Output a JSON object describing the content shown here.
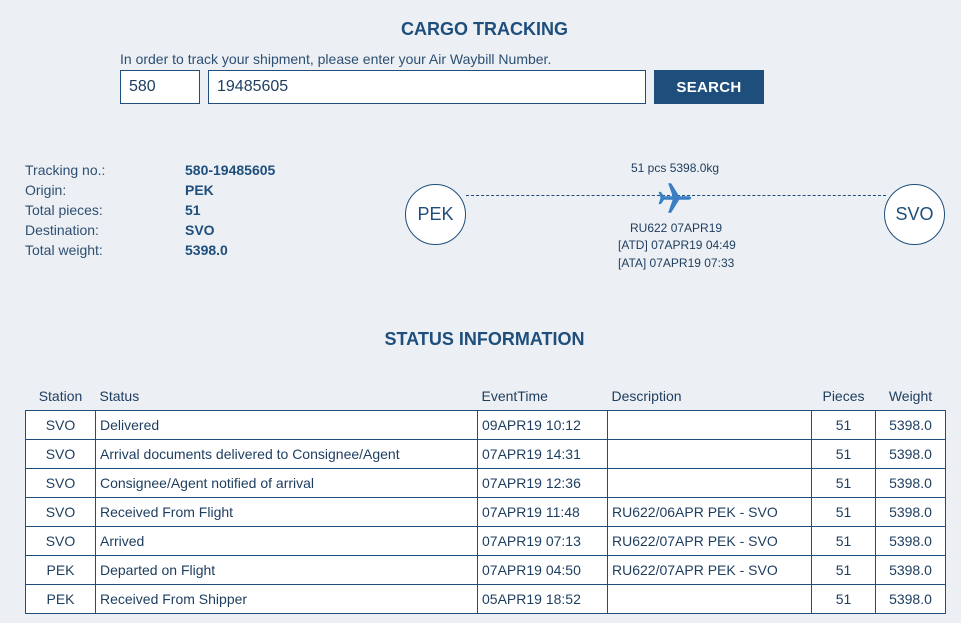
{
  "header": {
    "title": "CARGO TRACKING",
    "hint": "In order to track your shipment, please enter your Air Waybill Number.",
    "awb_prefix": "580",
    "awb_number": "19485605",
    "search_label": "SEARCH"
  },
  "summary": {
    "items": [
      {
        "label": "Tracking no.:",
        "value": "580-19485605"
      },
      {
        "label": "Origin:",
        "value": "PEK"
      },
      {
        "label": "Total pieces:",
        "value": "51"
      },
      {
        "label": "Destination:",
        "value": "SVO"
      },
      {
        "label": "Total weight:",
        "value": "5398.0"
      }
    ]
  },
  "route": {
    "origin": "PEK",
    "destination": "SVO",
    "cargo": "51 pcs 5398.0kg",
    "flight": "RU622 07APR19",
    "atd": "[ATD] 07APR19 04:49",
    "ata": "[ATA] 07APR19 07:33",
    "icon": "airplane-icon",
    "accent_color": "#1e4e7c",
    "plane_color": "#3a7fc4"
  },
  "status": {
    "title": "STATUS INFORMATION",
    "columns": [
      "Station",
      "Status",
      "EventTime",
      "Description",
      "Pieces",
      "Weight"
    ],
    "rows": [
      {
        "station": "SVO",
        "status": "Delivered",
        "time": "09APR19 10:12",
        "desc": "",
        "pieces": "51",
        "weight": "5398.0"
      },
      {
        "station": "SVO",
        "status": "Arrival documents delivered to Consignee/Agent",
        "time": "07APR19 14:31",
        "desc": "",
        "pieces": "51",
        "weight": "5398.0"
      },
      {
        "station": "SVO",
        "status": "Consignee/Agent notified of arrival",
        "time": "07APR19 12:36",
        "desc": "",
        "pieces": "51",
        "weight": "5398.0"
      },
      {
        "station": "SVO",
        "status": "Received From Flight",
        "time": "07APR19 11:48",
        "desc": "RU622/06APR PEK - SVO",
        "pieces": "51",
        "weight": "5398.0"
      },
      {
        "station": "SVO",
        "status": "Arrived",
        "time": "07APR19 07:13",
        "desc": "RU622/07APR PEK - SVO",
        "pieces": "51",
        "weight": "5398.0"
      },
      {
        "station": "PEK",
        "status": "Departed on Flight",
        "time": "07APR19 04:50",
        "desc": "RU622/07APR PEK - SVO",
        "pieces": "51",
        "weight": "5398.0"
      },
      {
        "station": "PEK",
        "status": "Received From Shipper",
        "time": "05APR19 18:52",
        "desc": "",
        "pieces": "51",
        "weight": "5398.0"
      }
    ]
  }
}
